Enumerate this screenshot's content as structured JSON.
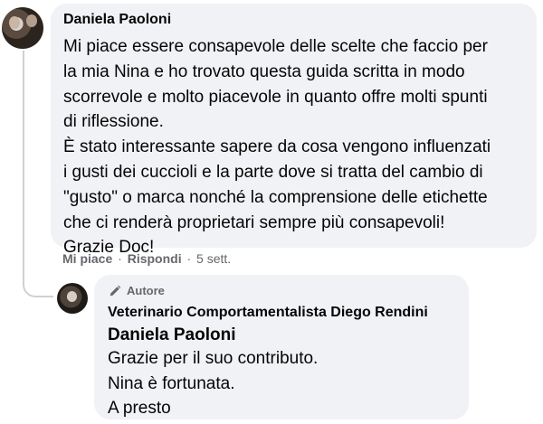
{
  "comment": {
    "author": "Daniela Paoloni",
    "lines": [
      "Mi piace essere consapevole delle scelte che faccio per",
      "la mia Nina e ho trovato questa guida scritta in modo",
      "scorrevole e molto piacevole in quanto offre molti spunti",
      "di riflessione.",
      "È stato interessante sapere da cosa vengono influenzati",
      "i gusti dei cuccioli e la parte dove si tratta del cambio di",
      "\"gusto\" o marca nonché la comprensione delle etichette",
      "che ci renderà proprietari sempre più consapevoli!",
      "Grazie Doc!"
    ],
    "actions": {
      "like": "Mi piace",
      "separator": "·",
      "reply": "Rispondi",
      "time": "5 sett."
    }
  },
  "reply": {
    "badge": "Autore",
    "badge_icon": "pencil-icon",
    "author": "Veterinario Comportamentalista Diego Rendini",
    "mention": "Daniela Paoloni",
    "lines": [
      "Grazie per il suo contributo.",
      "Nina è fortunata.",
      "A presto"
    ]
  },
  "colors": {
    "bubble": "#f0f2f5",
    "secondary_text": "#65676b",
    "text": "#050505",
    "connector": "#ced0d4"
  }
}
